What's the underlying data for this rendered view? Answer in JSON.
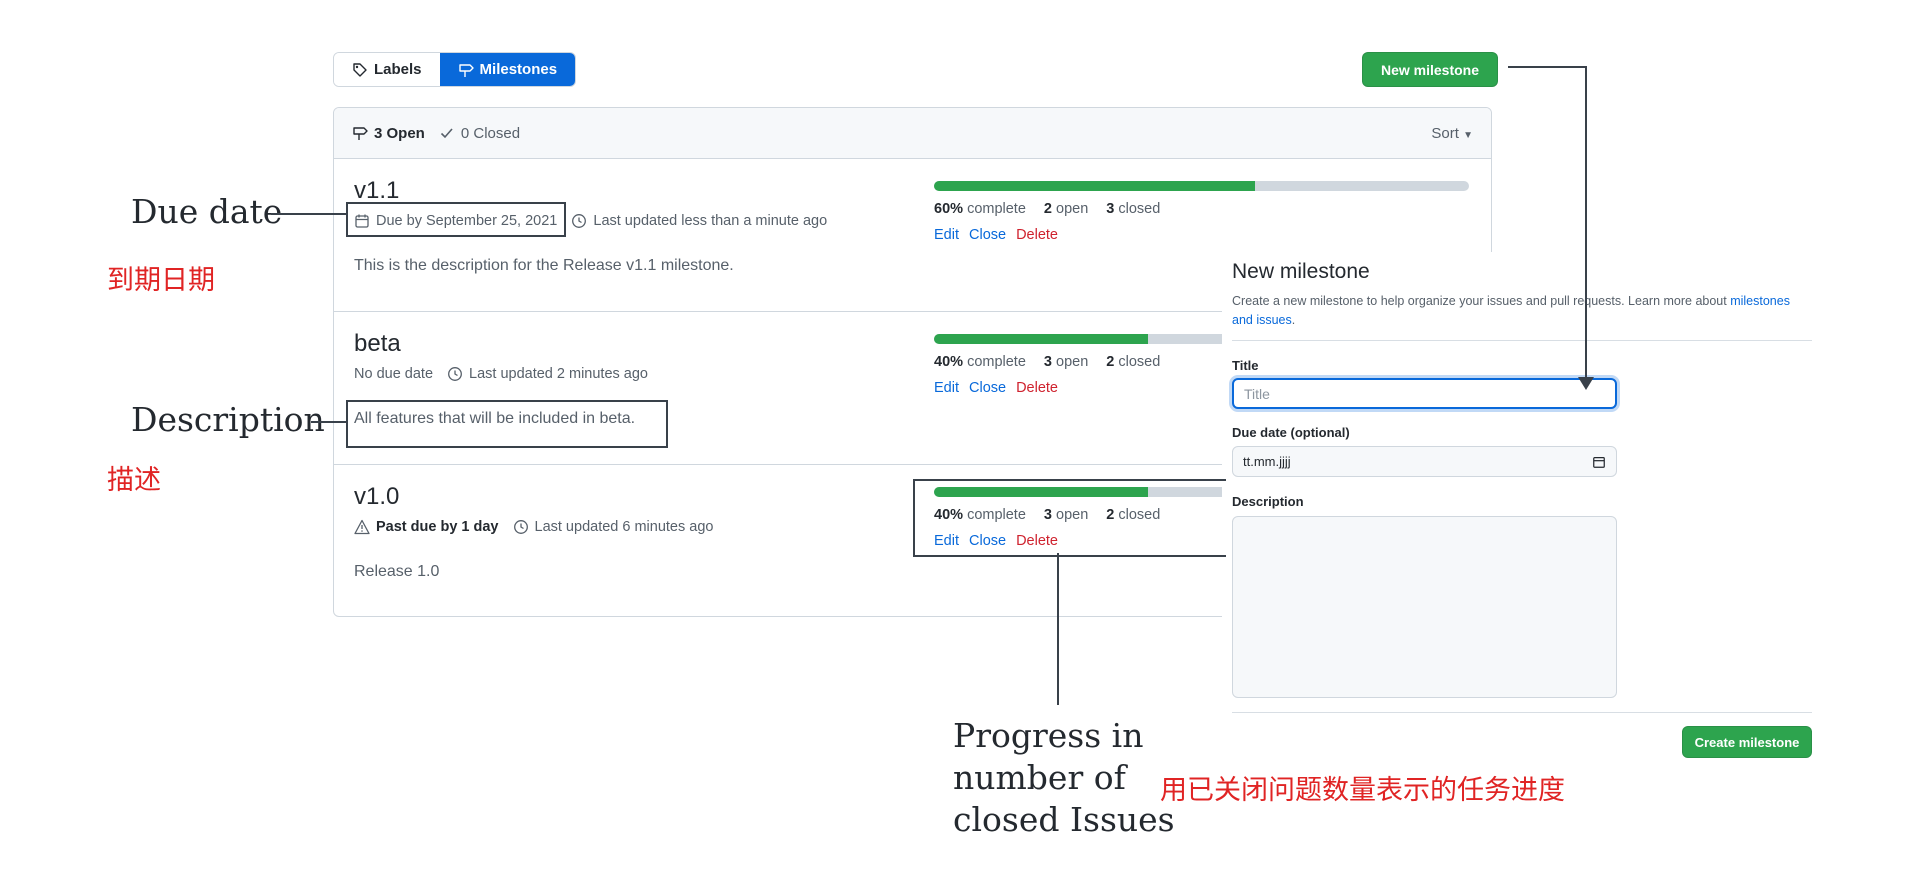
{
  "tabs": {
    "labels": "Labels",
    "milestones": "Milestones"
  },
  "new_milestone_button": "New milestone",
  "list_header": {
    "open": "3 Open",
    "closed": "0 Closed",
    "sort": "Sort"
  },
  "milestones": [
    {
      "title": "v1.1",
      "due": "Due by September 25, 2021",
      "updated": "Last updated less than a minute ago",
      "description": "This is the description for the Release v1.1 milestone.",
      "percent": "60%",
      "percent_value": 60,
      "open_count": "2",
      "closed_count": "3"
    },
    {
      "title": "beta",
      "due": "No due date",
      "updated": "Last updated 2 minutes ago",
      "description": "All features that will be included in beta.",
      "percent": "40%",
      "percent_value": 40,
      "open_count": "3",
      "closed_count": "2"
    },
    {
      "title": "v1.0",
      "due": "Past due by 1 day",
      "updated": "Last updated 6 minutes ago",
      "description": "Release 1.0",
      "percent": "40%",
      "percent_value": 40,
      "open_count": "3",
      "closed_count": "2"
    }
  ],
  "progress_words": {
    "complete": "complete",
    "open": "open",
    "closed": "closed"
  },
  "actions": {
    "edit": "Edit",
    "close": "Close",
    "delete": "Delete"
  },
  "form": {
    "title": "New milestone",
    "subtitle": "Create a new milestone to help organize your issues and pull requests. Learn more about",
    "subtitle_link": "milestones and issues",
    "subtitle_end": ".",
    "title_label": "Title",
    "title_placeholder": "Title",
    "due_label": "Due date (optional)",
    "due_value": "tt.mm.jjjj",
    "description_label": "Description",
    "create_button": "Create milestone"
  },
  "annotations": {
    "due_en": "Due date",
    "due_zh": "到期日期",
    "desc_en": "Description",
    "desc_zh": "描述",
    "progress_en_1": "Progress in",
    "progress_en_2": "number of",
    "progress_en_3": "closed Issues",
    "progress_zh": "用已关闭问题数量表示的任务进度"
  },
  "colors": {
    "green": "#2da44e",
    "blue": "#0969da",
    "red": "#cf222e",
    "annotation_red": "#e02424"
  }
}
